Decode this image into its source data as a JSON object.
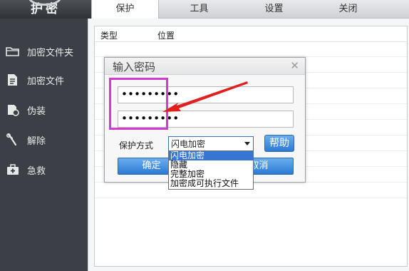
{
  "app": {
    "logo_text": "护密"
  },
  "tabs": [
    {
      "label": "保护",
      "active": true
    },
    {
      "label": "工具"
    },
    {
      "label": "设置"
    },
    {
      "label": "关闭"
    }
  ],
  "sidebar": {
    "items": [
      {
        "label": "加密文件夹",
        "icon": "folder-icon"
      },
      {
        "label": "加密文件",
        "icon": "file-icon"
      },
      {
        "label": "伪装",
        "icon": "disguise-icon"
      },
      {
        "label": "解除",
        "icon": "tools-icon"
      },
      {
        "label": "急救",
        "icon": "first-aid-icon"
      }
    ]
  },
  "list": {
    "columns": [
      "类型",
      "位置"
    ]
  },
  "dialog": {
    "title": "输入密码",
    "password1": "•••••••••",
    "password2": "•••••••••",
    "mode_label": "保护方式",
    "selected_mode": "闪电加密",
    "help_label": "帮助",
    "ok_label": "确定",
    "cancel_label": "取消"
  },
  "dropdown": {
    "options": [
      "闪电加密",
      "隐藏",
      "完整加密",
      "加密成可执行文件"
    ]
  },
  "colors": {
    "highlight_box": "#d23ad0",
    "arrow": "#e0201e",
    "accent": "#2d79d3"
  }
}
